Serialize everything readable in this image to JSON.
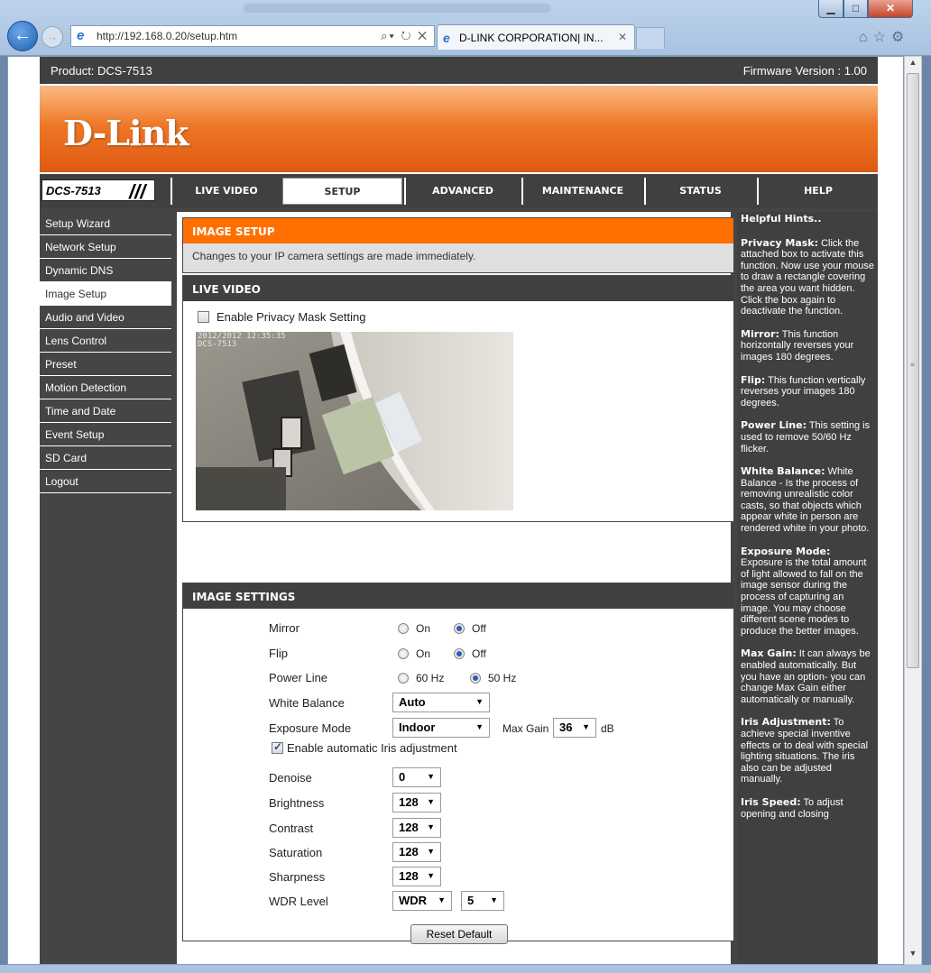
{
  "browser": {
    "url": "http://192.168.0.20/setup.htm",
    "tab_title": "D-LINK CORPORATION| IN..."
  },
  "page": {
    "product": "Product: DCS-7513",
    "firmware": "Firmware Version : 1.00",
    "logo": "D-Link",
    "model": "DCS-7513"
  },
  "nav": {
    "live_video": "LIVE VIDEO",
    "setup": "SETUP",
    "advanced": "ADVANCED",
    "maintenance": "MAINTENANCE",
    "status": "STATUS",
    "help": "HELP"
  },
  "sidebar": {
    "items": [
      {
        "label": "Setup Wizard"
      },
      {
        "label": "Network Setup"
      },
      {
        "label": "Dynamic DNS"
      },
      {
        "label": "Image Setup"
      },
      {
        "label": "Audio and Video"
      },
      {
        "label": "Lens Control"
      },
      {
        "label": "Preset"
      },
      {
        "label": "Motion Detection"
      },
      {
        "label": "Time and Date"
      },
      {
        "label": "Event Setup"
      },
      {
        "label": "SD Card"
      },
      {
        "label": "Logout"
      }
    ]
  },
  "image_setup": {
    "title": "IMAGE SETUP",
    "note": "Changes to your IP camera settings are made immediately."
  },
  "live_video": {
    "title": "LIVE VIDEO",
    "privacy_label": "Enable Privacy Mask Setting",
    "timestamp": "2012/2012 12:35:35\nDCS-7513"
  },
  "settings": {
    "title": "IMAGE SETTINGS",
    "mirror": {
      "label": "Mirror",
      "opt1": "On",
      "opt2": "Off",
      "selected": "Off"
    },
    "flip": {
      "label": "Flip",
      "opt1": "On",
      "opt2": "Off",
      "selected": "Off"
    },
    "power_line": {
      "label": "Power Line",
      "opt1": "60 Hz",
      "opt2": "50 Hz",
      "selected": "50 Hz"
    },
    "white_balance": {
      "label": "White Balance",
      "value": "Auto"
    },
    "exposure_mode": {
      "label": "Exposure Mode",
      "value": "Indoor",
      "max_gain_label": "Max Gain",
      "max_gain_value": "36",
      "unit": "dB"
    },
    "iris": {
      "label": "Enable automatic Iris adjustment",
      "checked": true
    },
    "denoise": {
      "label": "Denoise",
      "value": "0"
    },
    "brightness": {
      "label": "Brightness",
      "value": "128"
    },
    "contrast": {
      "label": "Contrast",
      "value": "128"
    },
    "saturation": {
      "label": "Saturation",
      "value": "128"
    },
    "sharpness": {
      "label": "Sharpness",
      "value": "128"
    },
    "wdr": {
      "label": "WDR Level",
      "value": "WDR",
      "level": "5"
    },
    "reset_label": "Reset Default"
  },
  "help": {
    "title": "Helpful Hints..",
    "hints": [
      {
        "term": "Privacy Mask:",
        "text": " Click the attached box to activate this function. Now use your mouse to draw a rectangle covering the area you want hidden. Click the box again to deactivate the function."
      },
      {
        "term": "Mirror:",
        "text": " This function horizontally reverses your images 180 degrees."
      },
      {
        "term": "Flip:",
        "text": " This function vertically reverses your images 180 degrees."
      },
      {
        "term": "Power Line:",
        "text": " This setting is used to remove 50/60 Hz flicker."
      },
      {
        "term": "White Balance:",
        "text": " White Balance - Is the process of removing unrealistic color casts, so that objects which appear white in person are rendered white in your photo."
      },
      {
        "term": "Exposure Mode:",
        "text": " Exposure is the total amount of light allowed to fall on the image sensor during the process of capturing an image. You may choose different scene modes to produce the better images."
      },
      {
        "term": "Max Gain:",
        "text": " It can always be enabled automatically. But you have an option- you can change Max Gain either automatically or manually."
      },
      {
        "term": "Iris Adjustment:",
        "text": " To achieve special inventive effects or to deal with special lighting situations. The iris also can be adjusted manually."
      },
      {
        "term": "Iris Speed:",
        "text": " To adjust opening and closing"
      }
    ]
  },
  "colors": {
    "orange": "#ff6f00",
    "dark": "#404040"
  }
}
